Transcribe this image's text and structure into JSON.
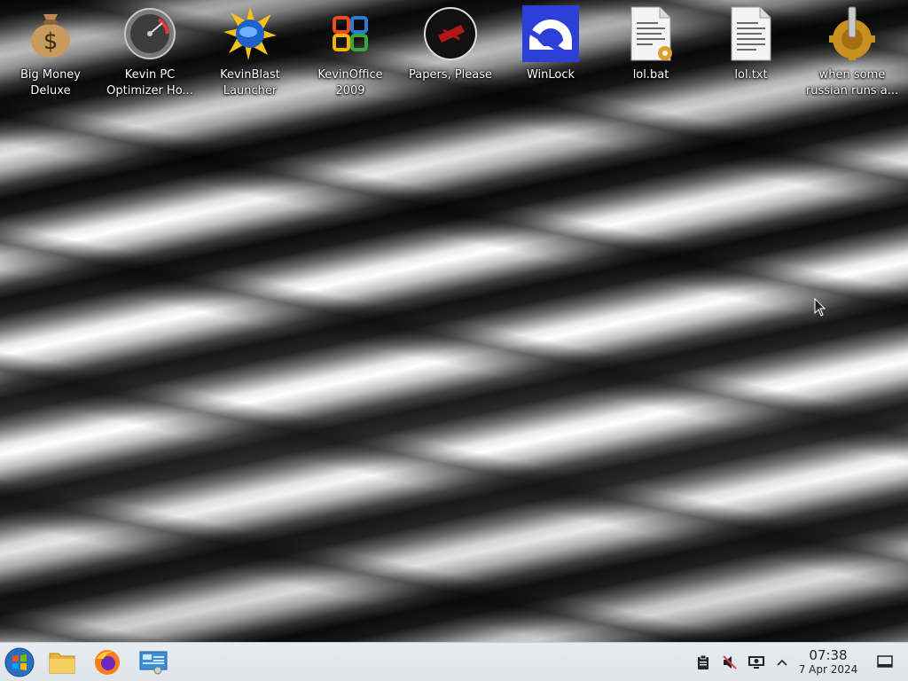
{
  "desktop": {
    "icons": [
      {
        "label": "Big Money\nDeluxe",
        "icon": "money-bag-icon"
      },
      {
        "label": "Kevin PC\nOptimizer Ho...",
        "icon": "speedometer-icon"
      },
      {
        "label": "KevinBlast\nLauncher",
        "icon": "blast-launcher-icon"
      },
      {
        "label": "KevinOffice\n2009",
        "icon": "office-logo-icon"
      },
      {
        "label": "Papers, Please",
        "icon": "papers-please-icon"
      },
      {
        "label": "WinLock",
        "icon": "winlock-icon"
      },
      {
        "label": "lol.bat",
        "icon": "batch-file-icon"
      },
      {
        "label": "lol.txt",
        "icon": "text-file-icon"
      },
      {
        "label": "when some\nrussian runs a...",
        "icon": "gear-icon"
      }
    ]
  },
  "taskbar": {
    "start_icon": "start-orb-icon",
    "pinned": [
      "file-manager-icon",
      "firefox-icon",
      "system-settings-icon"
    ],
    "tray": [
      "clipboard-icon",
      "volume-muted-icon",
      "display-icon",
      "chevron-up-icon"
    ],
    "clock": {
      "time": "07:38",
      "date": "7 Apr 2024"
    },
    "show_desktop_icon": "show-desktop-icon"
  },
  "colors": {
    "taskbar_bg": "#e3e8ed",
    "label_text": "#ffffff"
  }
}
